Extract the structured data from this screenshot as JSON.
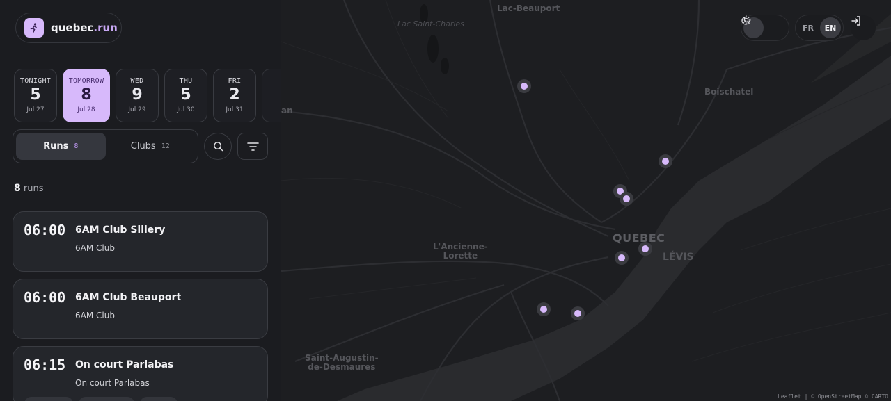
{
  "brand": {
    "name": "quebec",
    "tld": ".run"
  },
  "days": [
    {
      "label": "TONIGHT",
      "count": "5",
      "date": "Jul 27"
    },
    {
      "label": "TOMORROW",
      "count": "8",
      "date": "Jul 28"
    },
    {
      "label": "WED",
      "count": "9",
      "date": "Jul 29"
    },
    {
      "label": "THU",
      "count": "5",
      "date": "Jul 30"
    },
    {
      "label": "FRI",
      "count": "2",
      "date": "Jul 31"
    }
  ],
  "tabs": {
    "runs": {
      "label": "Runs",
      "count": "8"
    },
    "clubs": {
      "label": "Clubs",
      "count": "12"
    }
  },
  "results": {
    "count": "8",
    "unit": "runs"
  },
  "runs": [
    {
      "time": "06:00",
      "name": "6AM Club Sillery",
      "club": "6AM Club"
    },
    {
      "time": "06:00",
      "name": "6AM Club Beauport",
      "club": "6AM Club"
    },
    {
      "time": "06:15",
      "name": "On court Parlabas",
      "club": "On court Parlabas"
    }
  ],
  "map": {
    "labels": {
      "lac_beauport": "Lac-Beauport",
      "lac_saint_charles": "Lac Saint-Charles",
      "boischatel": "Boischatel",
      "quebec": "QUEBEC",
      "levis": "LÉVIS",
      "ancienne_lorette_1": "L'Ancienne-",
      "ancienne_lorette_2": "Lorette",
      "saint_augustin_1": "Saint-Augustin-",
      "saint_augustin_2": "de-Desmaures",
      "edge_an": "an"
    },
    "attribution": "Leaflet | © OpenStreetMap © CARTO"
  },
  "lang": {
    "fr": "FR",
    "en": "EN"
  },
  "colors": {
    "accent": "#d7b9fb",
    "background": "#1b1c20",
    "map": "#1d1e21"
  }
}
